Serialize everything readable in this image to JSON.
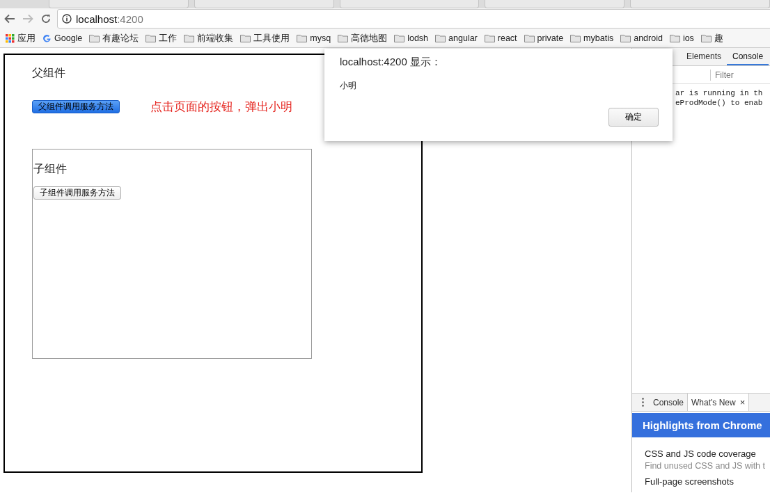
{
  "address_bar": {
    "host": "localhost",
    "port": ":4200"
  },
  "bookmarks": [
    {
      "label": "应用",
      "kind": "apps"
    },
    {
      "label": "Google",
      "kind": "google"
    },
    {
      "label": "有趣论坛",
      "kind": "folder"
    },
    {
      "label": "工作",
      "kind": "folder"
    },
    {
      "label": "前端收集",
      "kind": "folder"
    },
    {
      "label": "工具使用",
      "kind": "folder"
    },
    {
      "label": "mysq",
      "kind": "folder"
    },
    {
      "label": "高德地图",
      "kind": "folder"
    },
    {
      "label": "lodsh",
      "kind": "folder"
    },
    {
      "label": "angular",
      "kind": "folder"
    },
    {
      "label": "react",
      "kind": "folder"
    },
    {
      "label": "private",
      "kind": "folder"
    },
    {
      "label": "mybatis",
      "kind": "folder"
    },
    {
      "label": "android",
      "kind": "folder"
    },
    {
      "label": "ios",
      "kind": "folder"
    },
    {
      "label": "趣",
      "kind": "folder"
    }
  ],
  "page": {
    "parent_title": "父组件",
    "parent_button": {
      "label": "父组件调用服务方法",
      "focused": true
    },
    "annotation": "点击页面的按钮，弹出小明",
    "child_title": "子组件",
    "child_button": {
      "label": "子组件调用服务方法",
      "focused": false
    }
  },
  "dialog": {
    "title": "localhost:4200 显示：",
    "message": "小明",
    "ok_button": "确定"
  },
  "devtools": {
    "tabs": [
      {
        "label": "Elements",
        "selected": false
      },
      {
        "label": "Console",
        "selected": true
      }
    ],
    "filter_placeholder": "Filter",
    "console_lines": [
      "ar is running in th",
      "eProdMode() to enab"
    ],
    "drawer_tabs": [
      {
        "label": "Console",
        "selected": false
      },
      {
        "label": "What's New",
        "selected": true,
        "close": "×"
      }
    ],
    "whats_new": {
      "header": "Highlights from Chrome",
      "items": [
        {
          "title": "CSS and JS code coverage",
          "description": "Find unused CSS and JS with t"
        },
        {
          "title": "Full-page screenshots"
        }
      ]
    }
  }
}
